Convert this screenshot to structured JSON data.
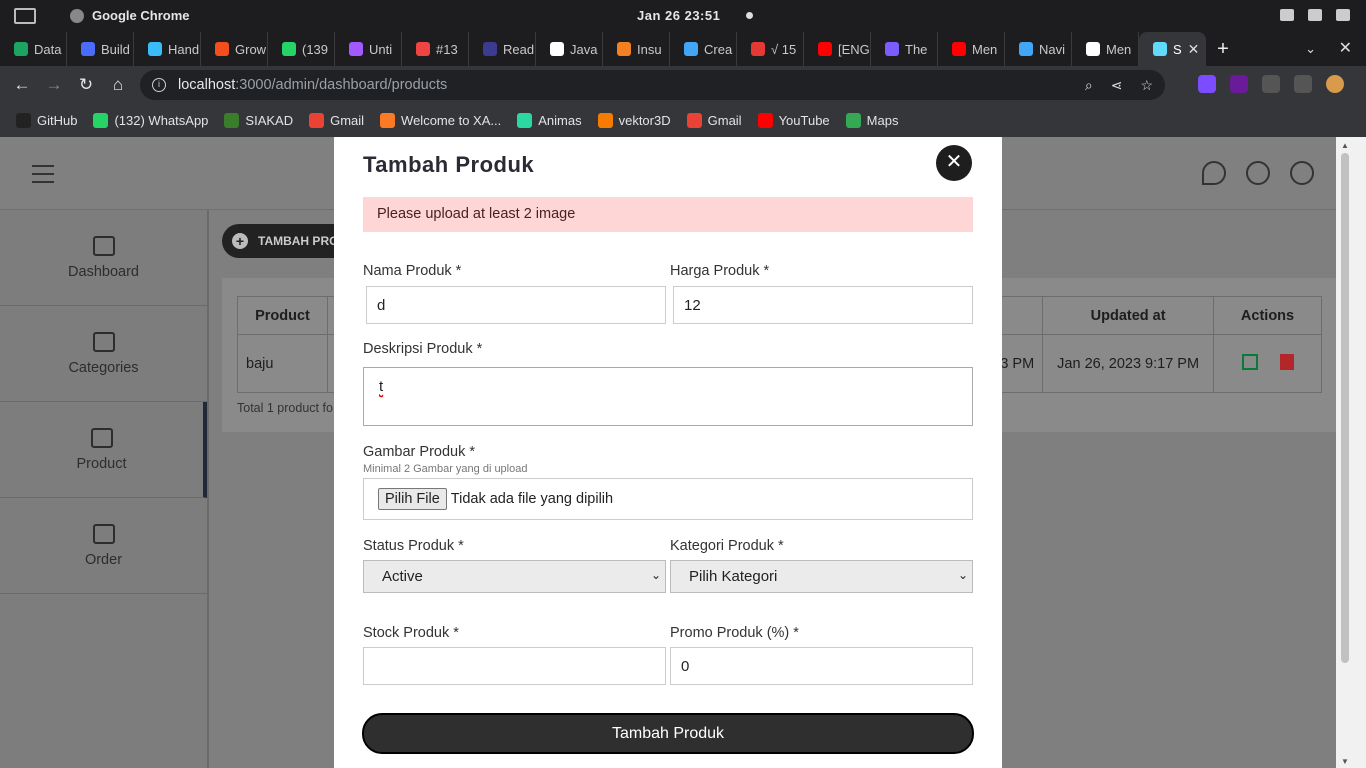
{
  "system": {
    "app_name": "Google Chrome",
    "clock": "Jan 26  23:51"
  },
  "tabs": [
    {
      "label": "Data",
      "color": "#1da462"
    },
    {
      "label": "Build",
      "color": "#4b6bfb"
    },
    {
      "label": "Hand",
      "color": "#38bdf8"
    },
    {
      "label": "Grow",
      "color": "#f24e1e"
    },
    {
      "label": "(139",
      "color": "#25d366"
    },
    {
      "label": "Unti",
      "color": "#a259ff"
    },
    {
      "label": "#13",
      "color": "#e44"
    },
    {
      "label": "Read",
      "color": "#3b3b8f"
    },
    {
      "label": "Java",
      "color": "#ffffff"
    },
    {
      "label": "Insu",
      "color": "#f48024"
    },
    {
      "label": "Crea",
      "color": "#42a5f5"
    },
    {
      "label": "√ 15",
      "color": "#e53935"
    },
    {
      "label": "[ENG",
      "color": "#ff0000"
    },
    {
      "label": "The",
      "color": "#7b5cff"
    },
    {
      "label": "Men",
      "color": "#ff0000"
    },
    {
      "label": "Navi",
      "color": "#42a5f5"
    },
    {
      "label": "Men",
      "color": "#ffffff"
    },
    {
      "label": "S",
      "color": "#61dafb"
    }
  ],
  "address": {
    "host": "localhost",
    "path": ":3000/admin/dashboard/products"
  },
  "bookmarks": [
    {
      "label": "GitHub",
      "color": "#222"
    },
    {
      "label": "(132) WhatsApp",
      "color": "#25d366"
    },
    {
      "label": "SIAKAD",
      "color": "#3a7d2c"
    },
    {
      "label": "Gmail",
      "color": "#ea4335"
    },
    {
      "label": "Welcome to XA...",
      "color": "#fb7a24"
    },
    {
      "label": "Animas",
      "color": "#2bd9a0"
    },
    {
      "label": "vektor3D",
      "color": "#f57c00"
    },
    {
      "label": "Gmail",
      "color": "#ea4335"
    },
    {
      "label": "YouTube",
      "color": "#ff0000"
    },
    {
      "label": "Maps",
      "color": "#34a853"
    }
  ],
  "sidebar": {
    "items": [
      {
        "label": "Dashboard",
        "icon": "chart-icon"
      },
      {
        "label": "Categories",
        "icon": "table-icon"
      },
      {
        "label": "Product",
        "icon": "archive-icon"
      },
      {
        "label": "Order",
        "icon": "clipboard-icon"
      }
    ]
  },
  "main": {
    "add_button": "TAMBAH PRODUK",
    "table": {
      "headers": [
        "Product",
        "",
        "Updated at",
        "Actions"
      ],
      "row": {
        "product": "baju",
        "created_partial": "3 PM",
        "updated": "Jan 26, 2023 9:17 PM"
      }
    },
    "footer": "Total 1 product fo"
  },
  "modal": {
    "title": "Tambah Produk",
    "alert": "Please upload at least 2 image",
    "name_label": "Nama Produk *",
    "name_value": "d",
    "price_label": "Harga Produk *",
    "price_value": "12",
    "desc_label": "Deskripsi Produk *",
    "desc_value": "t",
    "image_label": "Gambar Produk *",
    "image_hint": "Minimal 2 Gambar yang di upload",
    "file_button": "Pilih File",
    "file_status": "Tidak ada file yang dipilih",
    "status_label": "Status Produk *",
    "status_value": "Active",
    "category_label": "Kategori Produk *",
    "category_value": "Pilih Kategori",
    "stock_label": "Stock Produk *",
    "stock_value": "",
    "promo_label": "Promo Produk (%) *",
    "promo_value": "0",
    "submit": "Tambah Produk"
  }
}
